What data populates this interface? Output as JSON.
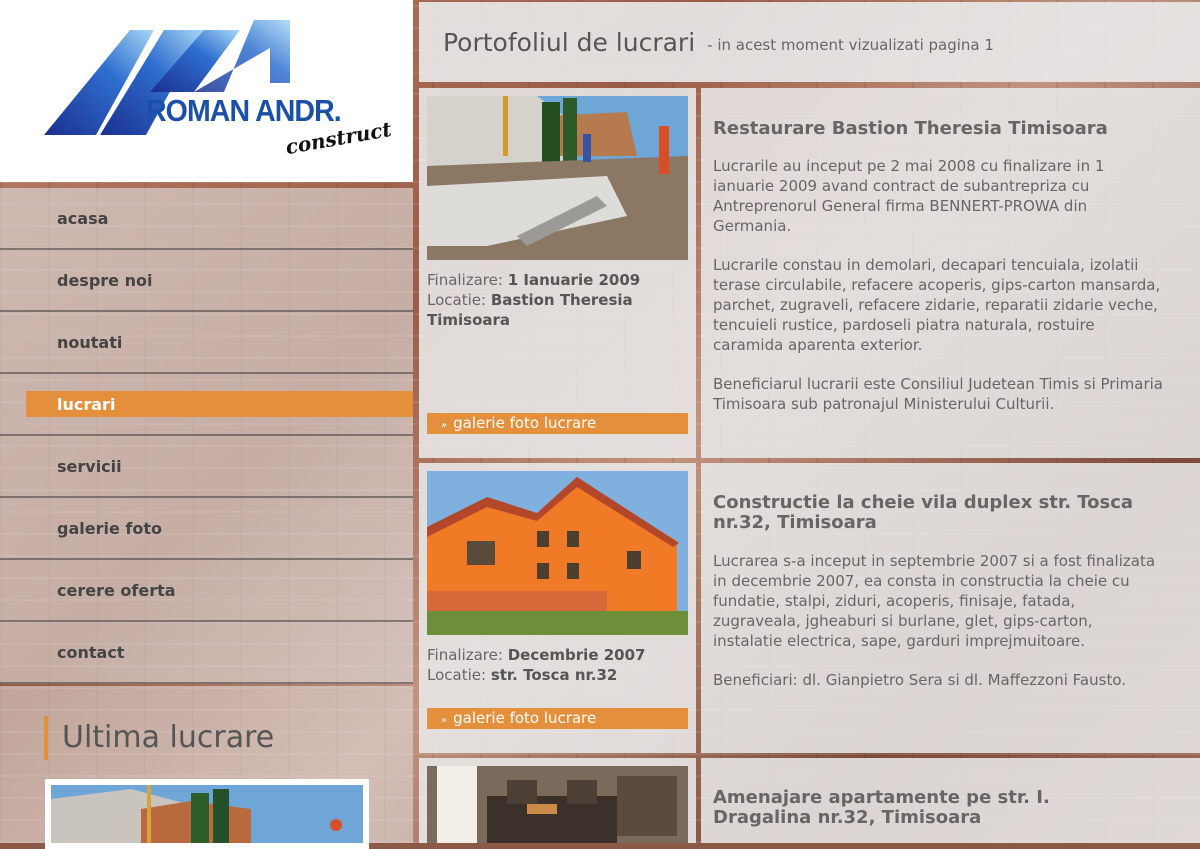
{
  "brand": {
    "name": "ROMAN ANDR.",
    "tagline": "construct",
    "colors": {
      "blue": "#1b4fa8",
      "light_blue": "#5fb3e6",
      "accent": "#e38f3c"
    }
  },
  "nav": {
    "items": [
      {
        "label": "acasa",
        "active": false
      },
      {
        "label": "despre noi",
        "active": false
      },
      {
        "label": "noutati",
        "active": false
      },
      {
        "label": "lucrari",
        "active": true
      },
      {
        "label": "servicii",
        "active": false
      },
      {
        "label": "galerie foto",
        "active": false
      },
      {
        "label": "cerere oferta",
        "active": false
      },
      {
        "label": "contact",
        "active": false
      }
    ]
  },
  "latest": {
    "title": "Ultima lucrare"
  },
  "page": {
    "title": "Portofoliul de lucrari",
    "subtitle": "- in acest moment vizualizati pagina 1"
  },
  "projects": [
    {
      "title": "Restaurare Bastion Theresia Timisoara",
      "finish_label": "Finalizare:",
      "finish_value": "1 Ianuarie 2009",
      "location_label": "Locatie:",
      "location_value": "Bastion Theresia Timisoara",
      "gallery_label": "galerie foto lucrare",
      "paragraphs": [
        "Lucrarile au inceput pe 2 mai 2008 cu finalizare in 1 ianuarie 2009 avand contract de subantrepriza cu Antreprenorul General firma BENNERT-PROWA din Germania.",
        "Lucrarile constau in demolari, decapari tencuiala, izolatii terase circulabile, refacere acoperis, gips-carton mansarda, parchet, zugraveli, refacere zidarie, reparatii zidarie veche, tencuieli rustice, pardoseli piatra naturala, rostuire caramida aparenta exterior.",
        "Beneficiarul lucrarii este Consiliul Judetean Timis si Primaria Timisoara sub patronajul Ministerului Culturii."
      ]
    },
    {
      "title": "Constructie la cheie vila duplex str. Tosca nr.32, Timisoara",
      "finish_label": "Finalizare:",
      "finish_value": "Decembrie 2007",
      "location_label": "Locatie:",
      "location_value": "str. Tosca nr.32",
      "gallery_label": "galerie foto lucrare",
      "paragraphs": [
        "Lucrarea s-a inceput in septembrie 2007 si a fost finalizata in decembrie 2007, ea consta in constructia la cheie cu fundatie, stalpi, ziduri, acoperis, finisaje, fatada, zugraveala, jgheaburi si burlane, glet, gips-carton, instalatie electrica, sape, garduri imprejmuitoare.",
        "Beneficiari: dl. Gianpietro Sera si dl. Maffezzoni Fausto."
      ]
    },
    {
      "title": "Amenajare apartamente pe str. I. Dragalina nr.32, Timisoara"
    }
  ]
}
